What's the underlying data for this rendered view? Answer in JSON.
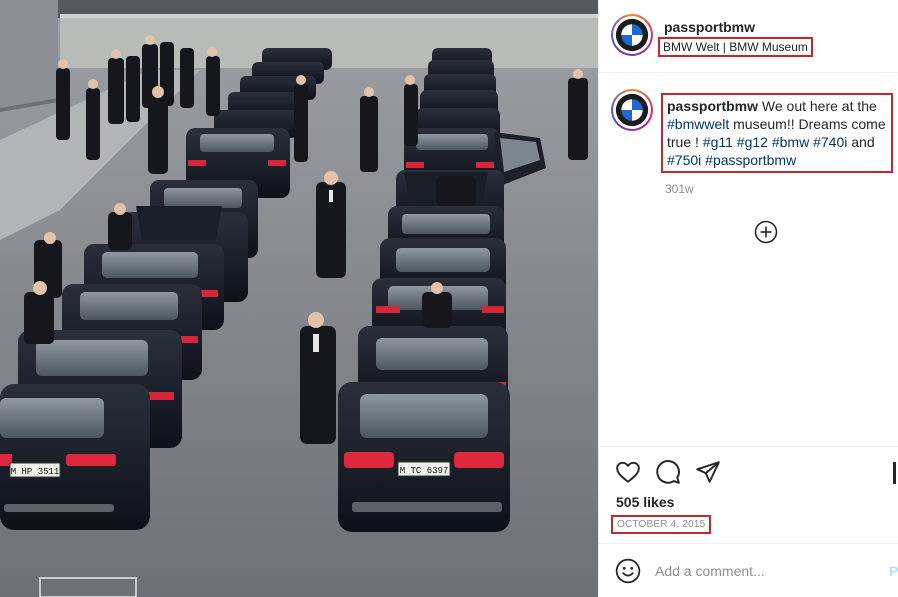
{
  "photo": {
    "plate_left": "M HP 3511",
    "plate_right": "M TC 6397"
  },
  "post": {
    "username": "passportbmw",
    "location": "BMW Welt | BMW Museum",
    "caption": {
      "username": "passportbmw",
      "text_1": " We out here at the ",
      "tag_1": "#bmwwelt",
      "text_2": " museum!! Dreams come true ! ",
      "tag_2": "#g11",
      "tag_3": "#g12",
      "tag_4": "#bmw",
      "tag_5": "#740i",
      "text_3": " and ",
      "tag_6": "#750i",
      "tag_7": "#passportbmw"
    },
    "time_ago": "301w",
    "likes": "505 likes",
    "date": "OCTOBER 4, 2015",
    "comment_placeholder": "Add a comment...",
    "post_label": "P"
  },
  "icons": {
    "avatar": "bmw-logo-icon",
    "load_more": "plus-circle-icon",
    "like": "heart-icon",
    "comment": "speech-bubble-icon",
    "share": "paper-plane-icon",
    "emoji": "smiley-icon"
  },
  "colors": {
    "highlight_box": "#c4262e",
    "hashtag": "#00376b",
    "muted": "#8e8e8e"
  }
}
